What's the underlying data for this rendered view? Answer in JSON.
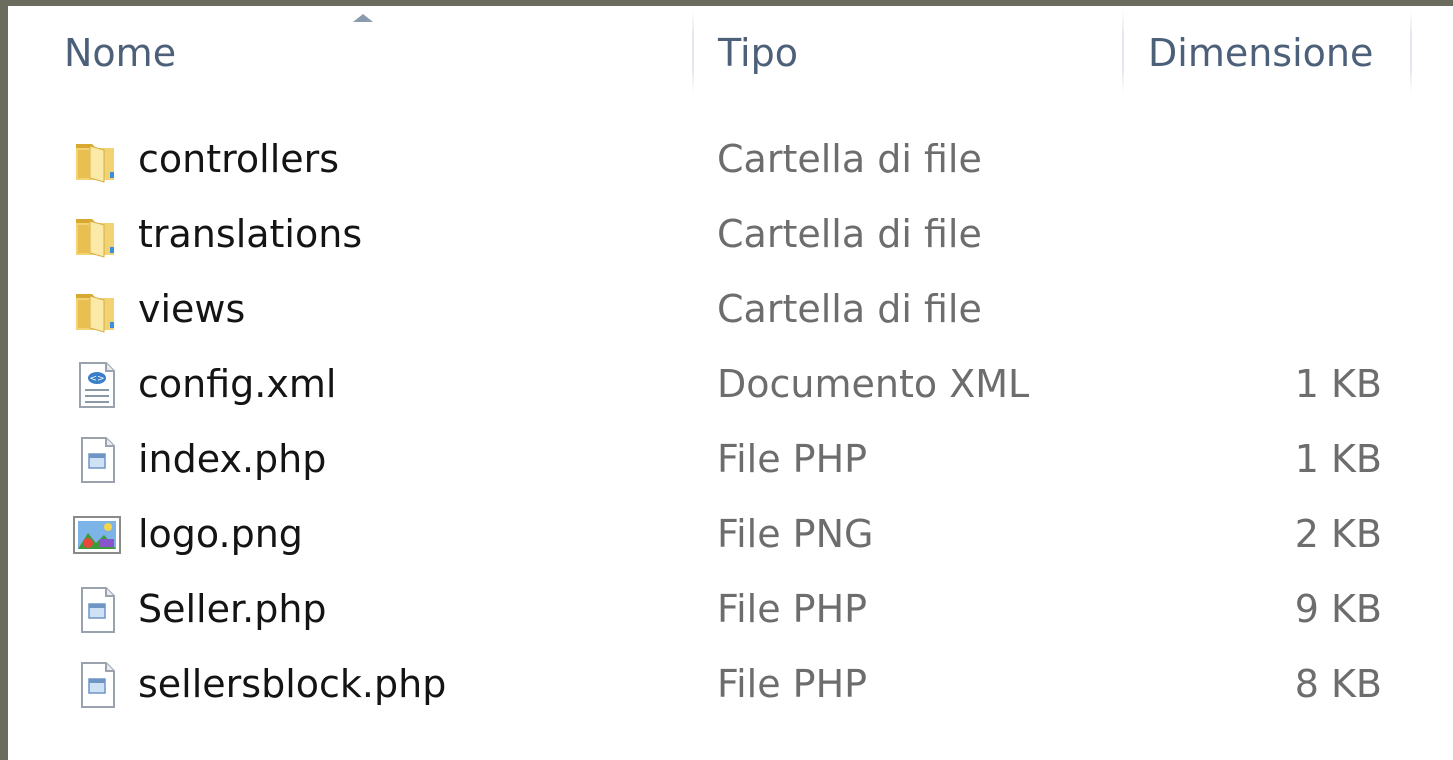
{
  "columns": {
    "name": "Nome",
    "type": "Tipo",
    "size": "Dimensione"
  },
  "sort": {
    "column": "name",
    "direction": "ascending"
  },
  "files": [
    {
      "name": "controllers",
      "type": "Cartella di file",
      "size": "",
      "icon": "folder-icon"
    },
    {
      "name": "translations",
      "type": "Cartella di file",
      "size": "",
      "icon": "folder-icon"
    },
    {
      "name": "views",
      "type": "Cartella di file",
      "size": "",
      "icon": "folder-icon"
    },
    {
      "name": "config.xml",
      "type": "Documento XML",
      "size": "1 KB",
      "icon": "xml-file-icon"
    },
    {
      "name": "index.php",
      "type": "File PHP",
      "size": "1 KB",
      "icon": "php-file-icon"
    },
    {
      "name": "logo.png",
      "type": "File PNG",
      "size": "2 KB",
      "icon": "image-file-icon"
    },
    {
      "name": "Seller.php",
      "type": "File PHP",
      "size": "9 KB",
      "icon": "php-file-icon"
    },
    {
      "name": "sellersblock.php",
      "type": "File PHP",
      "size": "8 KB",
      "icon": "php-file-icon"
    }
  ],
  "colors": {
    "header_text": "#4c607a",
    "name_text": "#141414",
    "detail_text": "#6d6d6d",
    "folder": "#e8c45a",
    "border": "#6b6b5e"
  }
}
